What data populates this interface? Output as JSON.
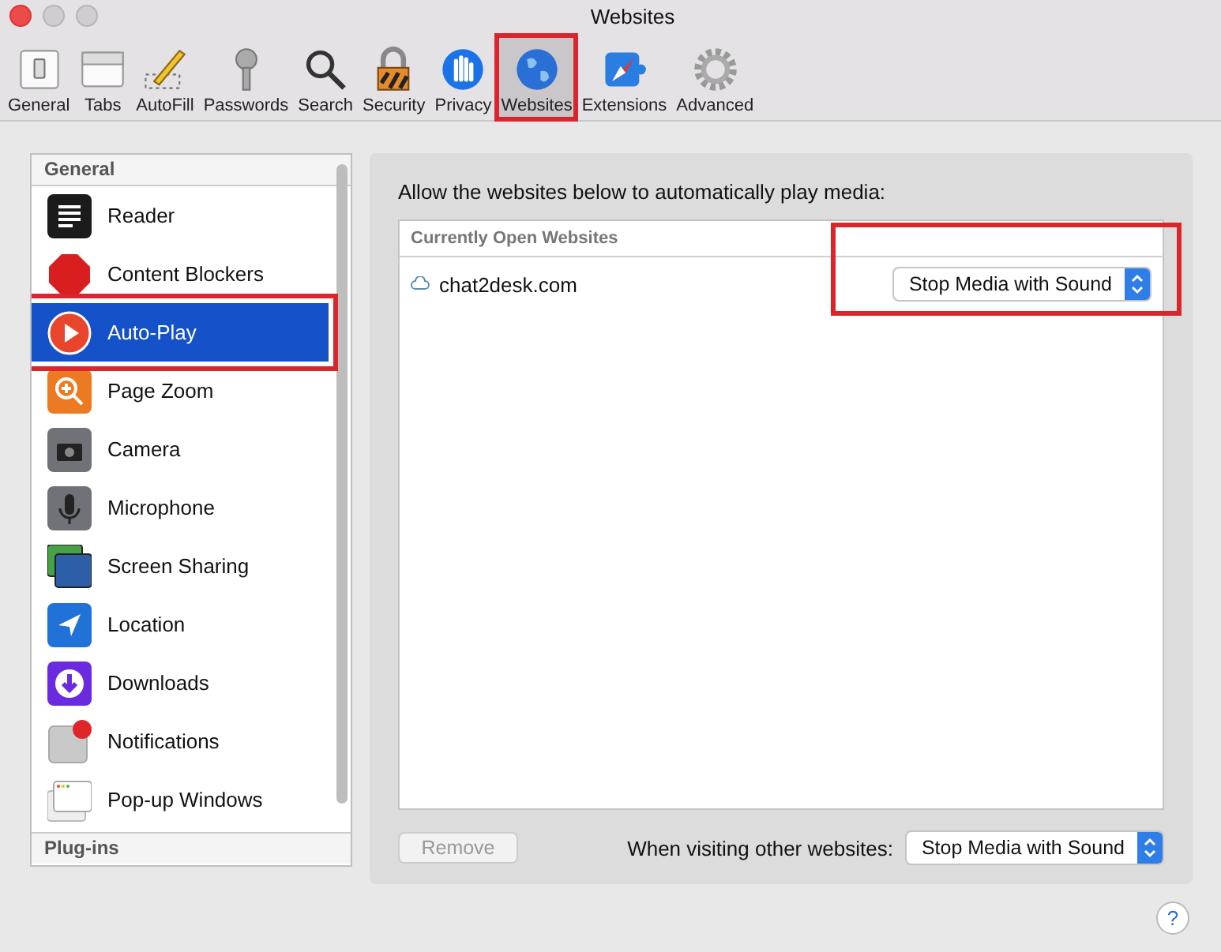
{
  "window": {
    "title": "Websites"
  },
  "toolbar": [
    {
      "label": "General",
      "selected": false,
      "annotated": false
    },
    {
      "label": "Tabs",
      "selected": false,
      "annotated": false
    },
    {
      "label": "AutoFill",
      "selected": false,
      "annotated": false
    },
    {
      "label": "Passwords",
      "selected": false,
      "annotated": false
    },
    {
      "label": "Search",
      "selected": false,
      "annotated": false
    },
    {
      "label": "Security",
      "selected": false,
      "annotated": false
    },
    {
      "label": "Privacy",
      "selected": false,
      "annotated": false
    },
    {
      "label": "Websites",
      "selected": true,
      "annotated": true
    },
    {
      "label": "Extensions",
      "selected": false,
      "annotated": false
    },
    {
      "label": "Advanced",
      "selected": false,
      "annotated": false
    }
  ],
  "sidebar": {
    "header": "General",
    "items": [
      {
        "label": "Reader",
        "selected": false,
        "annotated": false
      },
      {
        "label": "Content Blockers",
        "selected": false,
        "annotated": false
      },
      {
        "label": "Auto-Play",
        "selected": true,
        "annotated": true
      },
      {
        "label": "Page Zoom",
        "selected": false,
        "annotated": false
      },
      {
        "label": "Camera",
        "selected": false,
        "annotated": false
      },
      {
        "label": "Microphone",
        "selected": false,
        "annotated": false
      },
      {
        "label": "Screen Sharing",
        "selected": false,
        "annotated": false
      },
      {
        "label": "Location",
        "selected": false,
        "annotated": false
      },
      {
        "label": "Downloads",
        "selected": false,
        "annotated": false
      },
      {
        "label": "Notifications",
        "selected": false,
        "annotated": false
      },
      {
        "label": "Pop-up Windows",
        "selected": false,
        "annotated": false
      }
    ],
    "footer_header": "Plug-ins"
  },
  "panel": {
    "description": "Allow the websites below to automatically play media:",
    "table": {
      "header": "Currently Open Websites",
      "rows": [
        {
          "site": "chat2desk.com",
          "setting": "Stop Media with Sound",
          "annotated": true
        }
      ]
    },
    "remove_button": {
      "label": "Remove",
      "disabled": true
    },
    "other_label": "When visiting other websites:",
    "other_setting": "Stop Media with Sound"
  },
  "help_button": {
    "label": "?"
  }
}
